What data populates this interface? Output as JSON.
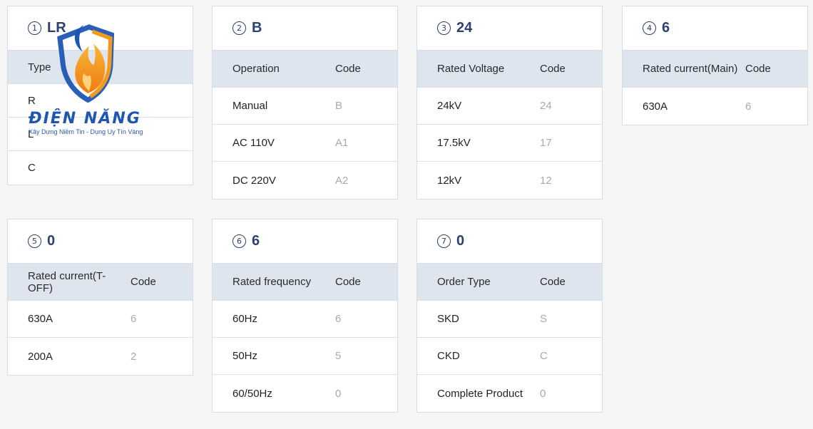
{
  "cards": [
    {
      "num": "1",
      "code": "LR",
      "header": {
        "c1": "Type",
        "c2": ""
      },
      "rows": [
        {
          "c1": "R",
          "c2": ""
        },
        {
          "c1": "L",
          "c2": ""
        },
        {
          "c1": "C",
          "c2": ""
        }
      ]
    },
    {
      "num": "2",
      "code": "B",
      "header": {
        "c1": "Operation",
        "c2": "Code"
      },
      "rows": [
        {
          "c1": "Manual",
          "c2": "B"
        },
        {
          "c1": "AC 110V",
          "c2": "A1"
        },
        {
          "c1": "DC 220V",
          "c2": "A2"
        }
      ]
    },
    {
      "num": "3",
      "code": "24",
      "header": {
        "c1": "Rated Voltage",
        "c2": "Code"
      },
      "rows": [
        {
          "c1": "24kV",
          "c2": "24"
        },
        {
          "c1": "17.5kV",
          "c2": "17"
        },
        {
          "c1": "12kV",
          "c2": "12"
        }
      ]
    },
    {
      "num": "4",
      "code": "6",
      "header": {
        "c1": "Rated current(Main)",
        "c2": "Code"
      },
      "rows": [
        {
          "c1": "630A",
          "c2": "6"
        }
      ]
    },
    {
      "num": "5",
      "code": "0",
      "header": {
        "c1": "Rated current(T-OFF)",
        "c2": "Code"
      },
      "rows": [
        {
          "c1": "630A",
          "c2": "6"
        },
        {
          "c1": "200A",
          "c2": "2"
        }
      ]
    },
    {
      "num": "6",
      "code": "6",
      "header": {
        "c1": "Rated frequency",
        "c2": "Code"
      },
      "rows": [
        {
          "c1": "60Hz",
          "c2": "6"
        },
        {
          "c1": "50Hz",
          "c2": "5"
        },
        {
          "c1": "60/50Hz",
          "c2": "0"
        }
      ]
    },
    {
      "num": "7",
      "code": "0",
      "header": {
        "c1": "Order Type",
        "c2": "Code"
      },
      "rows": [
        {
          "c1": "SKD",
          "c2": "S"
        },
        {
          "c1": "CKD",
          "c2": "C"
        },
        {
          "c1": "Complete Product",
          "c2": "0"
        }
      ]
    }
  ],
  "logo": {
    "name": "ĐIỆN NĂNG",
    "tagline": "Xây Dựng Niềm Tin - Dụng Uy Tín Vàng"
  },
  "colors": {
    "accent": "#2c4170",
    "header_bg": "#dfe5ef",
    "muted": "#aaaaaa",
    "logo_blue": "#1f56b3",
    "logo_orange": "#f39a1e"
  }
}
